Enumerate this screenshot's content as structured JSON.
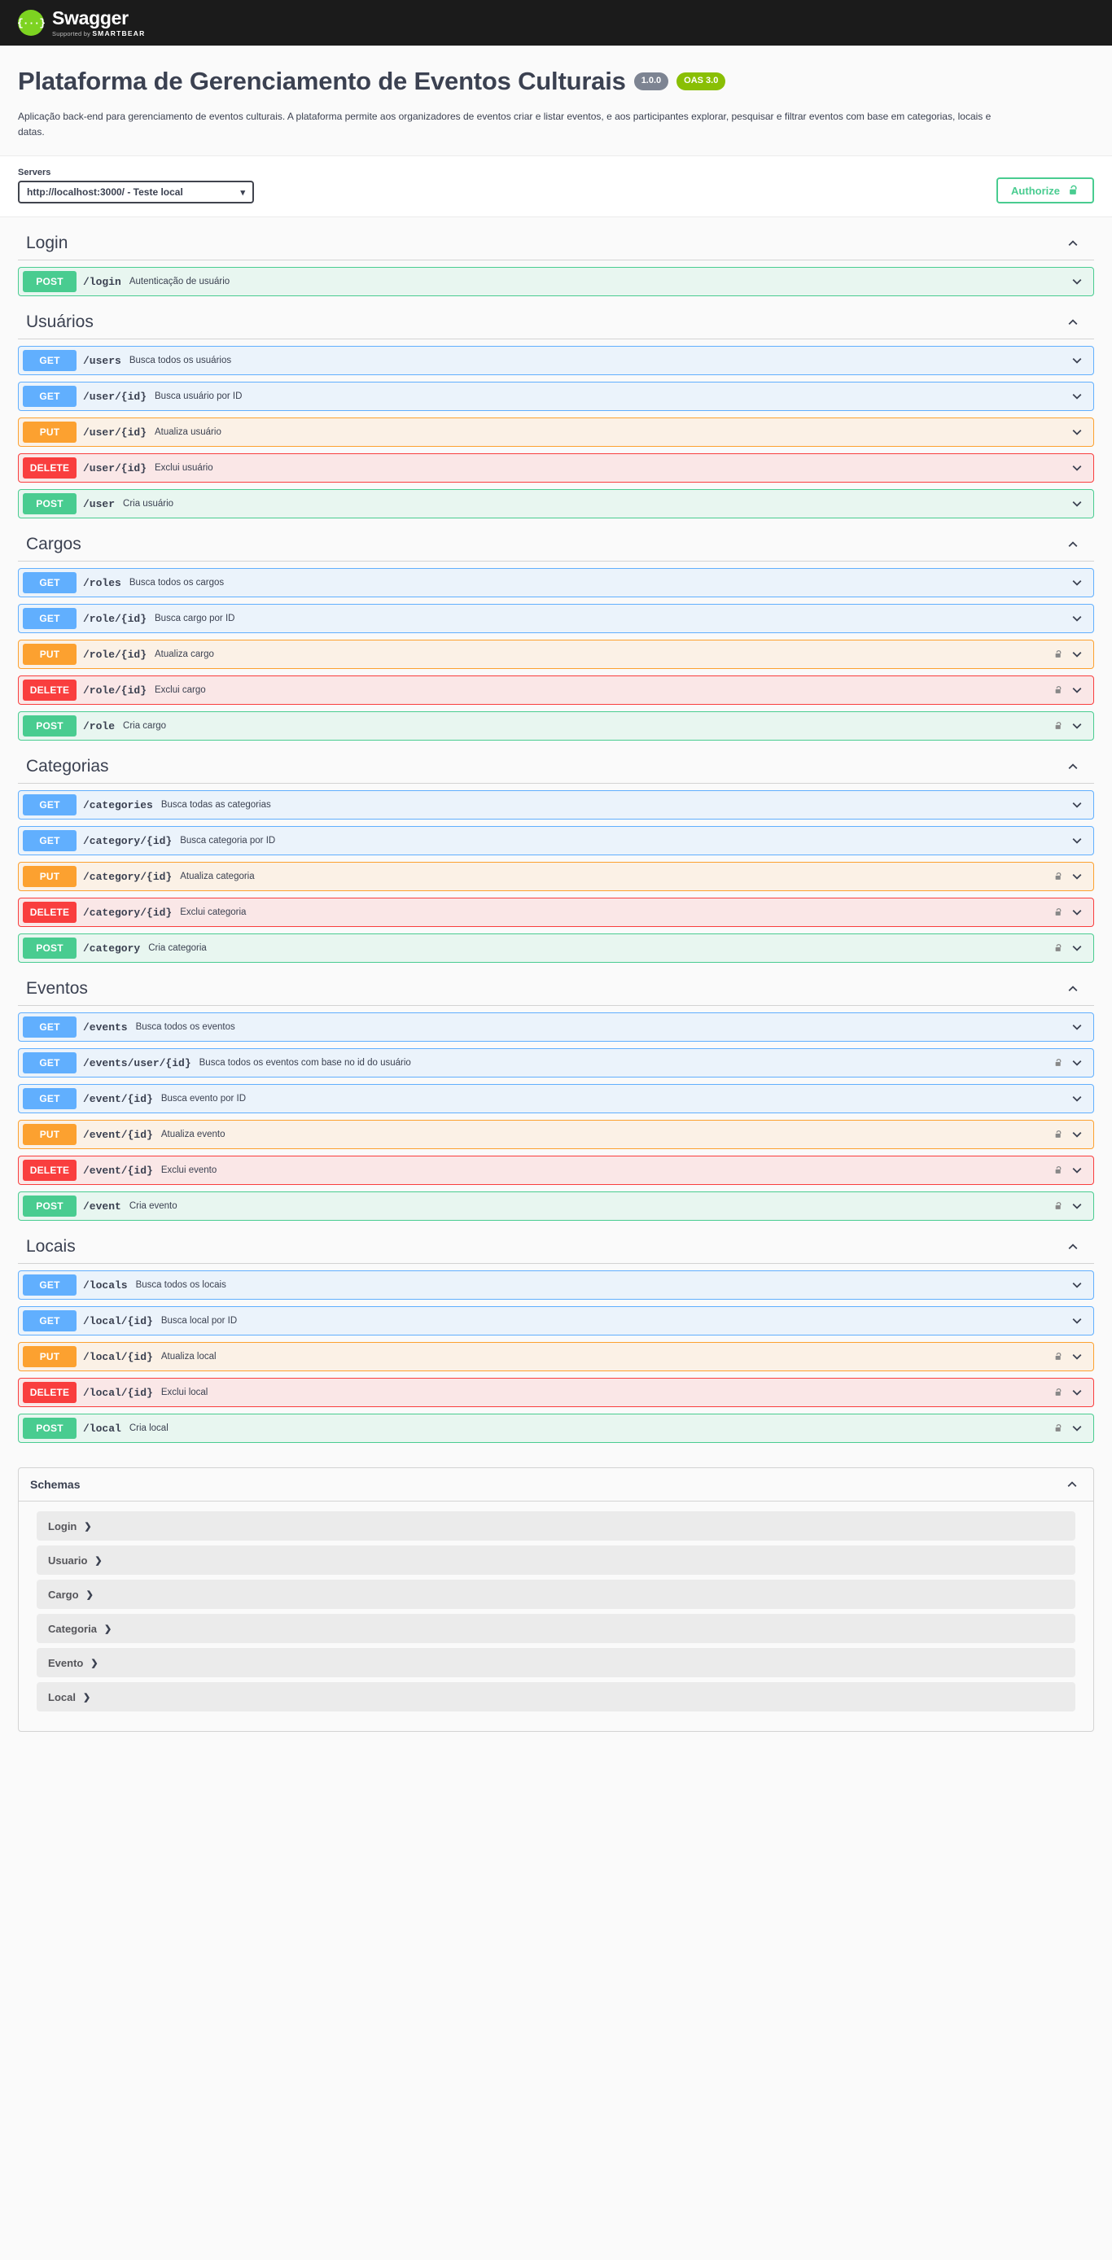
{
  "topbar": {
    "logo_glyph": "{···}",
    "brand": "Swagger",
    "supported_prefix": "Supported by",
    "supported_brand": "SMARTBEAR"
  },
  "info": {
    "title": "Plataforma de Gerenciamento de Eventos Culturais",
    "version_badge": "1.0.0",
    "oas_badge": "OAS 3.0",
    "description": "Aplicação back-end para gerenciamento de eventos culturais. A plataforma permite aos organizadores de eventos criar e listar eventos, e aos participantes explorar, pesquisar e filtrar eventos com base em categorias, locais e datas."
  },
  "scheme": {
    "servers_label": "Servers",
    "selected_server": "http://localhost:3000/ - Teste local",
    "authorize_label": "Authorize"
  },
  "colors": {
    "get": "#61affe",
    "post": "#49cc90",
    "put": "#fca130",
    "delete": "#f93e3e",
    "oas_green": "#89bf04",
    "version_gray": "#7d8492",
    "topbar_bg": "#1b1b1b",
    "logo_green": "#7dd321"
  },
  "sections": [
    {
      "name": "Login",
      "operations": [
        {
          "method": "POST",
          "cls": "post",
          "path": "/login",
          "summary": "Autenticação de usuário",
          "locked": false
        }
      ]
    },
    {
      "name": "Usuários",
      "operations": [
        {
          "method": "GET",
          "cls": "get",
          "path": "/users",
          "summary": "Busca todos os usuários",
          "locked": false
        },
        {
          "method": "GET",
          "cls": "get",
          "path": "/user/{id}",
          "summary": "Busca usuário por ID",
          "locked": false
        },
        {
          "method": "PUT",
          "cls": "put",
          "path": "/user/{id}",
          "summary": "Atualiza usuário",
          "locked": false
        },
        {
          "method": "DELETE",
          "cls": "delete",
          "path": "/user/{id}",
          "summary": "Exclui usuário",
          "locked": false
        },
        {
          "method": "POST",
          "cls": "post",
          "path": "/user",
          "summary": "Cria usuário",
          "locked": false
        }
      ]
    },
    {
      "name": "Cargos",
      "operations": [
        {
          "method": "GET",
          "cls": "get",
          "path": "/roles",
          "summary": "Busca todos os cargos",
          "locked": false
        },
        {
          "method": "GET",
          "cls": "get",
          "path": "/role/{id}",
          "summary": "Busca cargo por ID",
          "locked": false
        },
        {
          "method": "PUT",
          "cls": "put",
          "path": "/role/{id}",
          "summary": "Atualiza cargo",
          "locked": true
        },
        {
          "method": "DELETE",
          "cls": "delete",
          "path": "/role/{id}",
          "summary": "Exclui cargo",
          "locked": true
        },
        {
          "method": "POST",
          "cls": "post",
          "path": "/role",
          "summary": "Cria cargo",
          "locked": true
        }
      ]
    },
    {
      "name": "Categorias",
      "operations": [
        {
          "method": "GET",
          "cls": "get",
          "path": "/categories",
          "summary": "Busca todas as categorias",
          "locked": false
        },
        {
          "method": "GET",
          "cls": "get",
          "path": "/category/{id}",
          "summary": "Busca categoria por ID",
          "locked": false
        },
        {
          "method": "PUT",
          "cls": "put",
          "path": "/category/{id}",
          "summary": "Atualiza categoria",
          "locked": true
        },
        {
          "method": "DELETE",
          "cls": "delete",
          "path": "/category/{id}",
          "summary": "Exclui categoria",
          "locked": true
        },
        {
          "method": "POST",
          "cls": "post",
          "path": "/category",
          "summary": "Cria categoria",
          "locked": true
        }
      ]
    },
    {
      "name": "Eventos",
      "operations": [
        {
          "method": "GET",
          "cls": "get",
          "path": "/events",
          "summary": "Busca todos os eventos",
          "locked": false
        },
        {
          "method": "GET",
          "cls": "get",
          "path": "/events/user/{id}",
          "summary": "Busca todos os eventos com base no id do usuário",
          "locked": true
        },
        {
          "method": "GET",
          "cls": "get",
          "path": "/event/{id}",
          "summary": "Busca evento por ID",
          "locked": false
        },
        {
          "method": "PUT",
          "cls": "put",
          "path": "/event/{id}",
          "summary": "Atualiza evento",
          "locked": true
        },
        {
          "method": "DELETE",
          "cls": "delete",
          "path": "/event/{id}",
          "summary": "Exclui evento",
          "locked": true
        },
        {
          "method": "POST",
          "cls": "post",
          "path": "/event",
          "summary": "Cria evento",
          "locked": true
        }
      ]
    },
    {
      "name": "Locais",
      "operations": [
        {
          "method": "GET",
          "cls": "get",
          "path": "/locals",
          "summary": "Busca todos os locais",
          "locked": false
        },
        {
          "method": "GET",
          "cls": "get",
          "path": "/local/{id}",
          "summary": "Busca local por ID",
          "locked": false
        },
        {
          "method": "PUT",
          "cls": "put",
          "path": "/local/{id}",
          "summary": "Atualiza local",
          "locked": true
        },
        {
          "method": "DELETE",
          "cls": "delete",
          "path": "/local/{id}",
          "summary": "Exclui local",
          "locked": true
        },
        {
          "method": "POST",
          "cls": "post",
          "path": "/local",
          "summary": "Cria local",
          "locked": true
        }
      ]
    }
  ],
  "models": {
    "title": "Schemas",
    "items": [
      {
        "name": "Login"
      },
      {
        "name": "Usuario"
      },
      {
        "name": "Cargo"
      },
      {
        "name": "Categoria"
      },
      {
        "name": "Evento"
      },
      {
        "name": "Local"
      }
    ]
  }
}
